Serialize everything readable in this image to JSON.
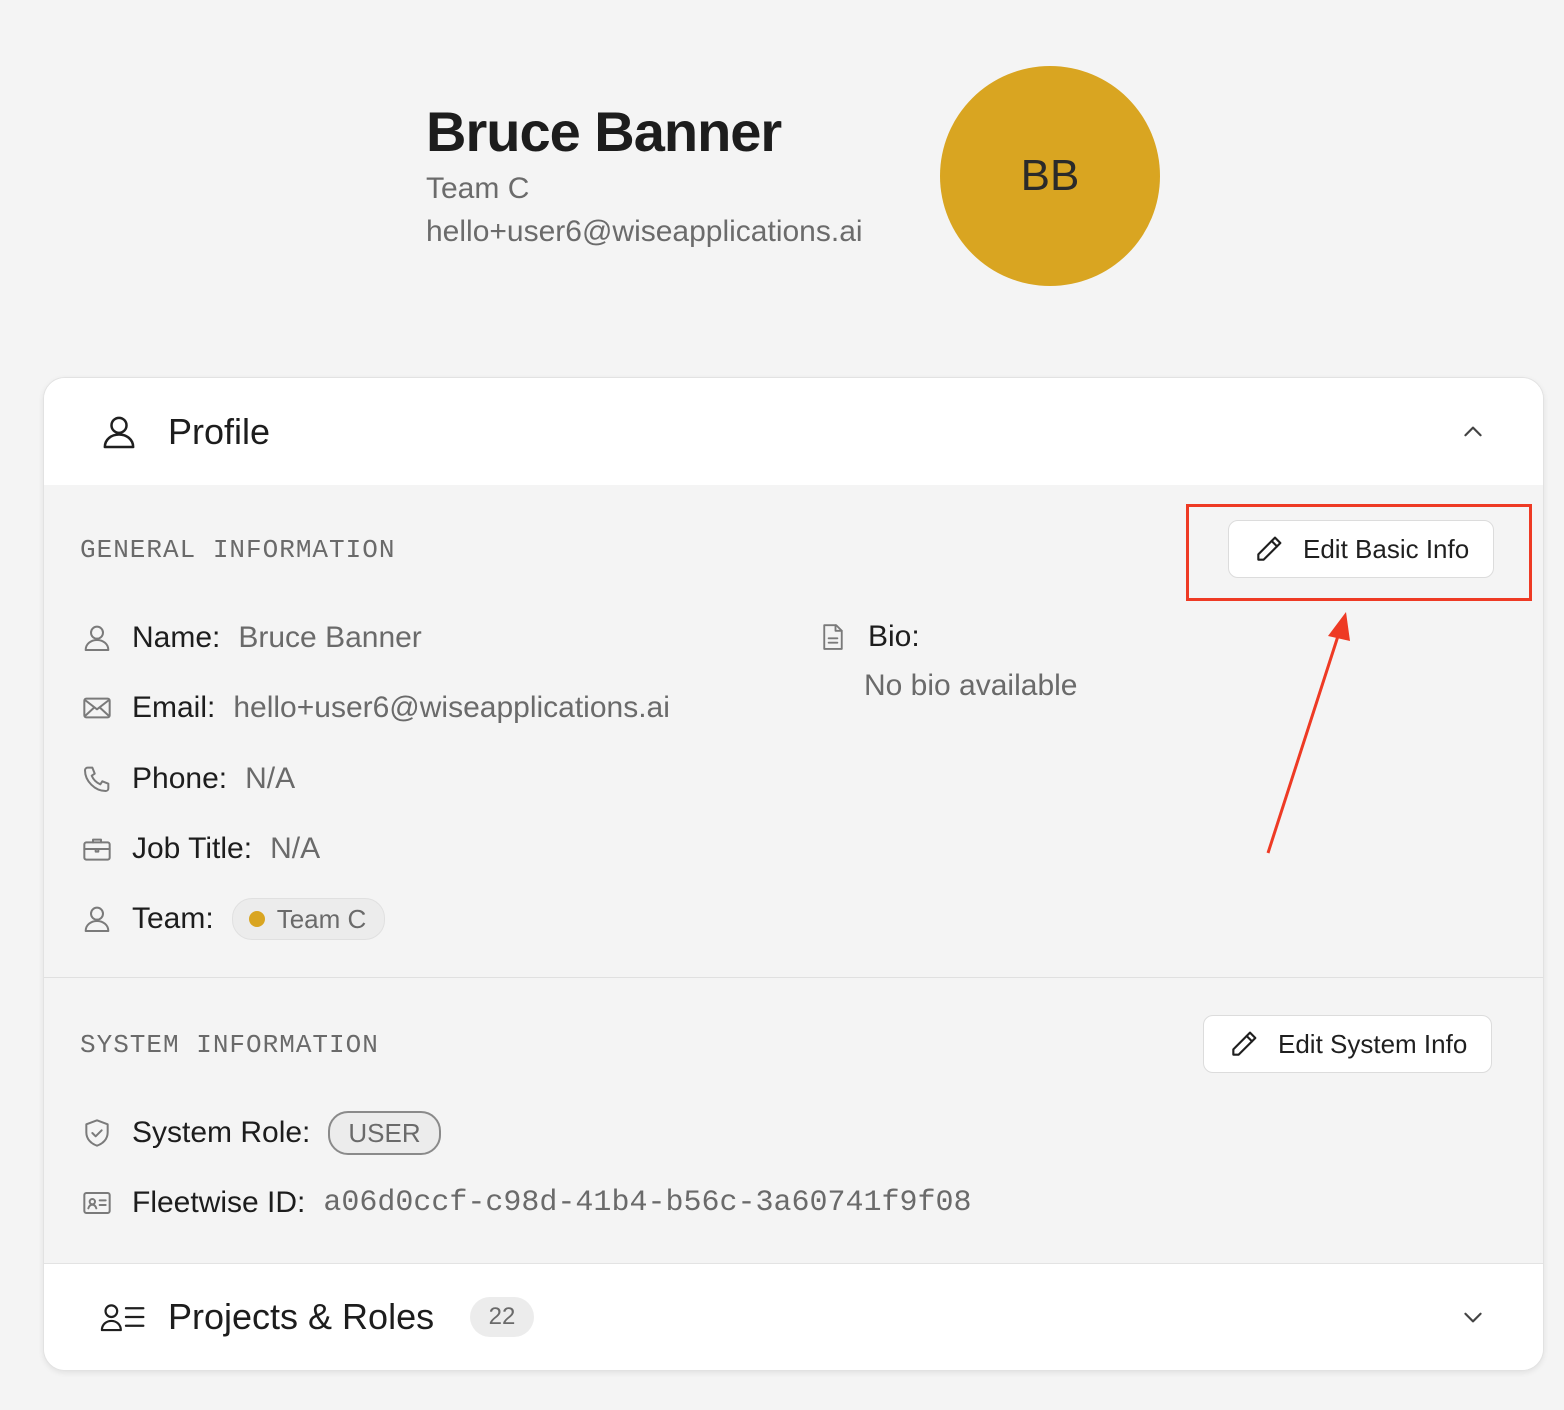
{
  "user": {
    "name": "Bruce Banner",
    "team": "Team C",
    "email": "hello+user6@wiseapplications.ai",
    "initials": "BB",
    "avatar_color": "#D9A521"
  },
  "profile_section": {
    "title": "Profile",
    "icon": "user-icon",
    "expanded": true,
    "general": {
      "label": "GENERAL INFORMATION",
      "edit_button": "Edit Basic Info",
      "fields": {
        "name": {
          "label": "Name:",
          "value": "Bruce Banner",
          "icon": "user-icon"
        },
        "email": {
          "label": "Email:",
          "value": "hello+user6@wiseapplications.ai",
          "icon": "mail-icon"
        },
        "phone": {
          "label": "Phone:",
          "value": "N/A",
          "icon": "phone-icon"
        },
        "job_title": {
          "label": "Job Title:",
          "value": "N/A",
          "icon": "briefcase-icon"
        },
        "team": {
          "label": "Team:",
          "value": "Team C",
          "icon": "user-icon",
          "dot_color": "#D9A521"
        }
      },
      "bio": {
        "label": "Bio:",
        "value": "No bio available",
        "icon": "document-icon"
      }
    },
    "system": {
      "label": "SYSTEM INFORMATION",
      "edit_button": "Edit System Info",
      "fields": {
        "role": {
          "label": "System Role:",
          "value": "USER",
          "icon": "shield-icon"
        },
        "fleetwise_id": {
          "label": "Fleetwise ID:",
          "value": "a06d0ccf-c98d-41b4-b56c-3a60741f9f08",
          "icon": "id-card-icon"
        }
      }
    }
  },
  "projects_section": {
    "title": "Projects & Roles",
    "count": "22",
    "icon": "user-list-icon",
    "expanded": false
  },
  "annotation": {
    "color": "#EE3A24"
  }
}
